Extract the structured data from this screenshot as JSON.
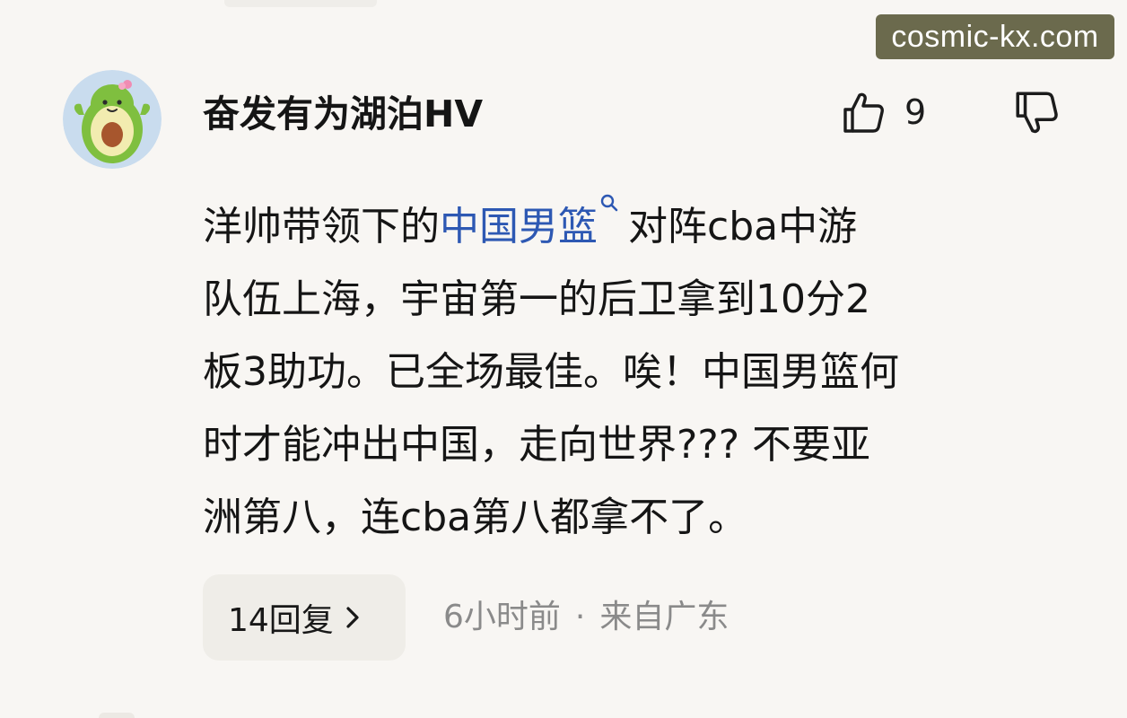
{
  "watermark": "cosmic-kx.com",
  "comment": {
    "username": "奋发有为湖泊HV",
    "avatar_icon": "avocado-avatar-icon",
    "like_icon": "thumbs-up-icon",
    "like_count": "9",
    "dislike_icon": "thumbs-down-icon",
    "text": {
      "line1_pre": "洋帅带领下的",
      "topic_link": "中国男篮",
      "topic_link_icon": "search-icon",
      "line1_post": "对阵cba中游",
      "line2": "队伍上海，宇宙第一的后卫拿到10分2",
      "line3": "板3助功。已全场最佳。唉！中国男篮何",
      "line4": "时才能冲出中国，走向世界??? 不要亚",
      "line5": "洲第八，连cba第八都拿不了。"
    },
    "replies_label": "14回复",
    "replies_icon": "chevron-right-icon",
    "time": "6小时前",
    "separator": "·",
    "location": "来自广东"
  },
  "colors": {
    "background": "#f8f6f3",
    "link": "#2d58b3",
    "meta_text": "#8a8a8a",
    "watermark_bg": "#6b6a4d",
    "avatar_bg": "#c9dcee",
    "avocado_green": "#7fbf3f"
  }
}
